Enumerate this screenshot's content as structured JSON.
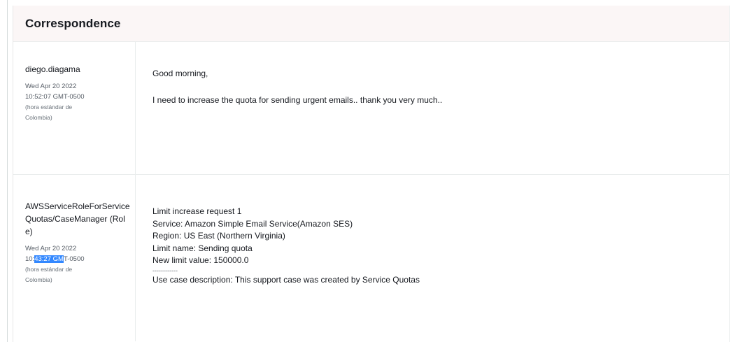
{
  "panel": {
    "title": "Correspondence"
  },
  "entries": [
    {
      "author": "diego.diagama",
      "date_line1": "Wed Apr 20 2022",
      "date_line2": "10:52:07 GMT-0500",
      "tz_line1": "(hora estándar de",
      "tz_line2": "Colombia)",
      "message_lines": [
        "Good morning,",
        "I need to increase the quota for sending urgent emails.. thank you very much.."
      ]
    },
    {
      "author": "AWSServiceRoleForServiceQuotas/CaseManager (Role)",
      "date_line1": "Wed Apr 20 2022",
      "time_prefix": "10:",
      "time_selected": "43:27 GM",
      "time_suffix": "T-0500",
      "tz_line1": "(hora estándar de",
      "tz_line2": "Colombia)",
      "message_lines": [
        "Limit increase request 1",
        "Service: Amazon Simple Email Service(Amazon SES)",
        "Region: US East (Northern Virginia)",
        "Limit name: Sending quota",
        "New limit value: 150000.0",
        "------------",
        "Use case description: This support case was created by Service Quotas"
      ]
    }
  ]
}
